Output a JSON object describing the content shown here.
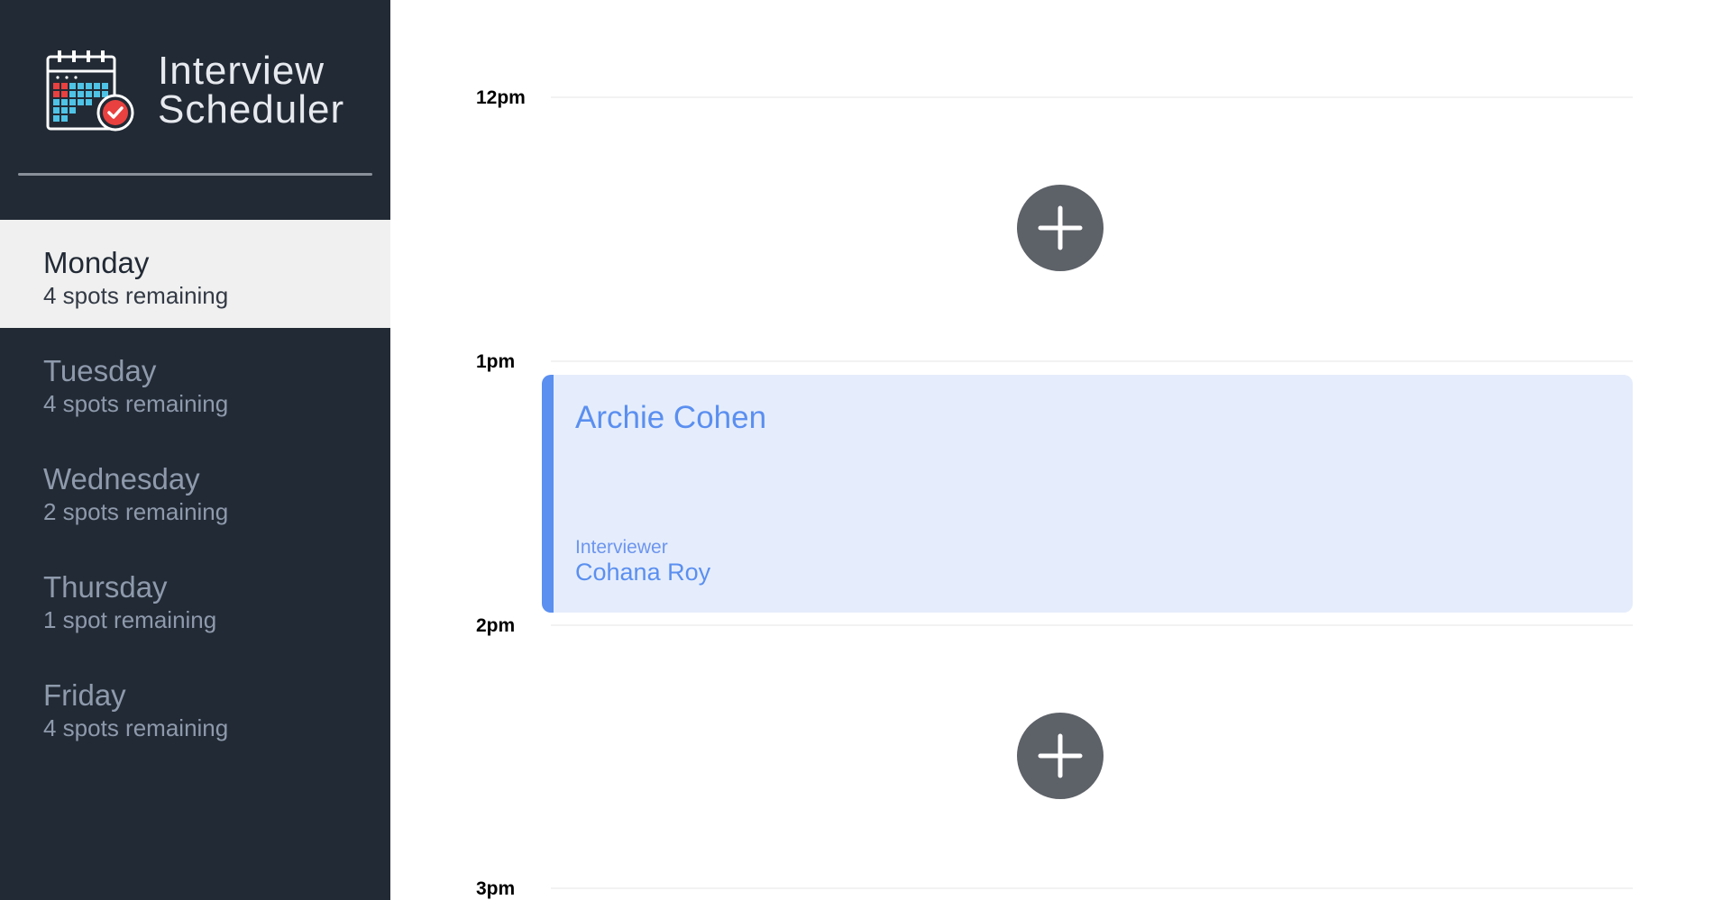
{
  "app": {
    "title_line1": "Interview",
    "title_line2": "Scheduler",
    "logo_icon": "calendar-check-icon"
  },
  "sidebar": {
    "days": [
      {
        "name": "Monday",
        "spots": "4 spots remaining",
        "selected": true
      },
      {
        "name": "Tuesday",
        "spots": "4 spots remaining",
        "selected": false
      },
      {
        "name": "Wednesday",
        "spots": "2 spots remaining",
        "selected": false
      },
      {
        "name": "Thursday",
        "spots": "1 spot remaining",
        "selected": false
      },
      {
        "name": "Friday",
        "spots": "4 spots remaining",
        "selected": false
      }
    ]
  },
  "schedule": {
    "slots": [
      {
        "time": "12pm",
        "type": "empty",
        "action_icon": "plus-icon"
      },
      {
        "time": "1pm",
        "type": "booked",
        "student": "Archie Cohen",
        "interviewer_label": "Interviewer",
        "interviewer": "Cohana Roy"
      },
      {
        "time": "2pm",
        "type": "empty",
        "action_icon": "plus-icon"
      },
      {
        "time": "3pm",
        "type": "empty"
      }
    ]
  },
  "colors": {
    "sidebar_bg": "#222a35",
    "selected_day_bg": "#f0f0f0",
    "appointment_bg": "#e5edfc",
    "appointment_accent": "#5b8ff0",
    "add_button": "#5d6168"
  }
}
